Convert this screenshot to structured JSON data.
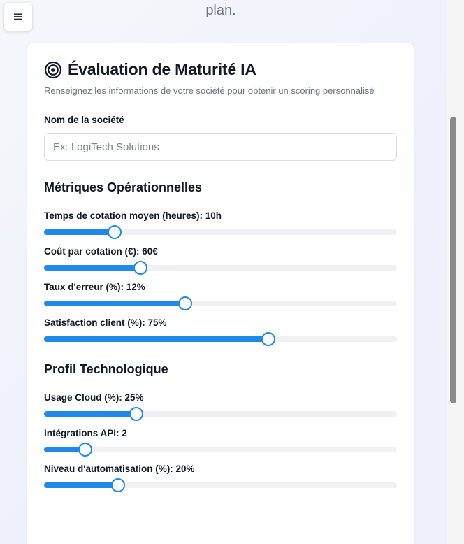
{
  "header": {
    "top_text": "plan.",
    "menu_icon": "hamburger-menu-icon"
  },
  "card": {
    "icon": "target-icon",
    "title": "Évaluation de Maturité IA",
    "description": "Renseignez les informations de votre société pour obtenir un scoring personnalisé"
  },
  "company": {
    "label": "Nom de la société",
    "placeholder": "Ex: LogiTech Solutions",
    "value": ""
  },
  "sections": {
    "operational": "Métriques Opérationnelles",
    "technology": "Profil Technologique"
  },
  "sliders": {
    "quote_time": {
      "label": "Temps de cotation moyen (heures): 10h",
      "value": 10,
      "min": 0,
      "max": 50
    },
    "quote_cost": {
      "label": "Coût par cotation (€): 60€",
      "value": 60,
      "min": 0,
      "max": 220
    },
    "error_rate": {
      "label": "Taux d'erreur (%): 12%",
      "value": 12,
      "min": 0,
      "max": 30
    },
    "satisfaction": {
      "label": "Satisfaction client (%): 75%",
      "value": 75,
      "min": 0,
      "max": 118
    },
    "cloud_usage": {
      "label": "Usage Cloud (%): 25%",
      "value": 25,
      "min": 0,
      "max": 96
    },
    "api_integrations": {
      "label": "Intégrations API: 2",
      "value": 2,
      "min": 0,
      "max": 17
    },
    "automation": {
      "label": "Niveau d'automatisation (%): 20%",
      "value": 20,
      "min": 0,
      "max": 95
    }
  },
  "colors": {
    "accent": "#2189e9",
    "track": "#f1f1f3"
  }
}
